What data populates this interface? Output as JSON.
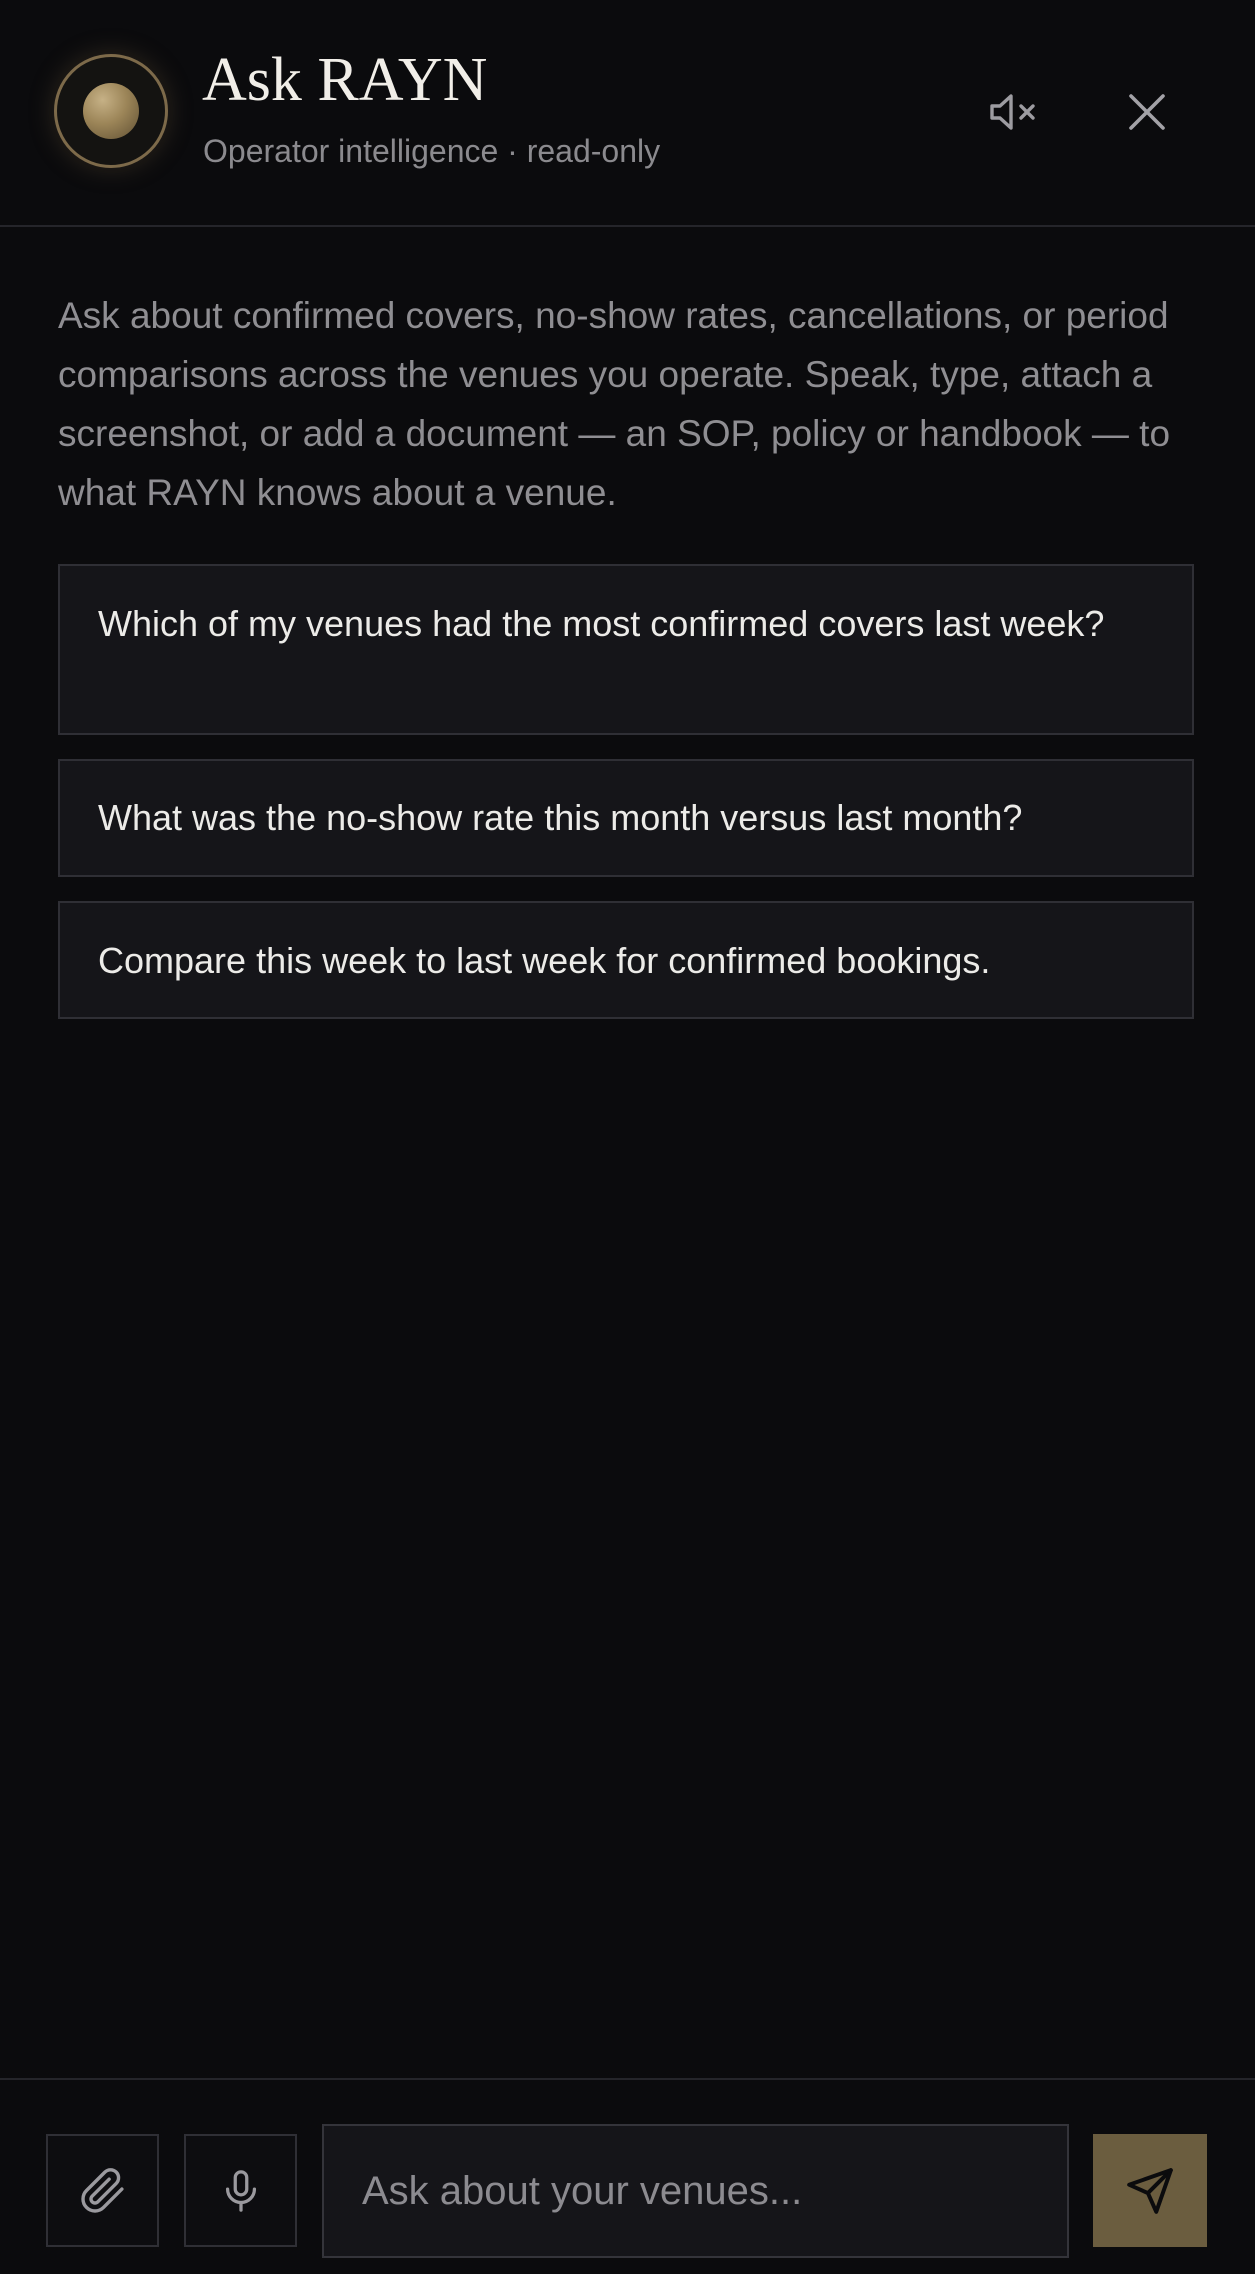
{
  "header": {
    "title": "Ask RAYN",
    "subtitle": "Operator intelligence · read-only",
    "avatar_icon": "orb-avatar-icon",
    "mute_icon": "speaker-muted-icon",
    "close_icon": "close-icon"
  },
  "intro": {
    "text": "Ask about confirmed covers, no-show rates, cancellations, or period comparisons across the venues you operate. Speak, type, attach a screenshot, or add a document — an SOP, policy or handbook — to what RAYN knows about a venue."
  },
  "suggestions": [
    {
      "label": "Which of my venues had the most confirmed covers last week?"
    },
    {
      "label": "What was the no-show rate this month versus last month?"
    },
    {
      "label": "Compare this week to last week for confirmed bookings."
    }
  ],
  "composer": {
    "placeholder": "Ask about your venues...",
    "value": "",
    "attach_icon": "paperclip-icon",
    "mic_icon": "microphone-icon",
    "send_icon": "send-icon"
  },
  "colors": {
    "background": "#0b0b0d",
    "accent_gold": "#6b5d3f",
    "avatar_ring": "#7d6a4a",
    "card_bg": "#151519",
    "muted_text": "#8f8e92"
  }
}
